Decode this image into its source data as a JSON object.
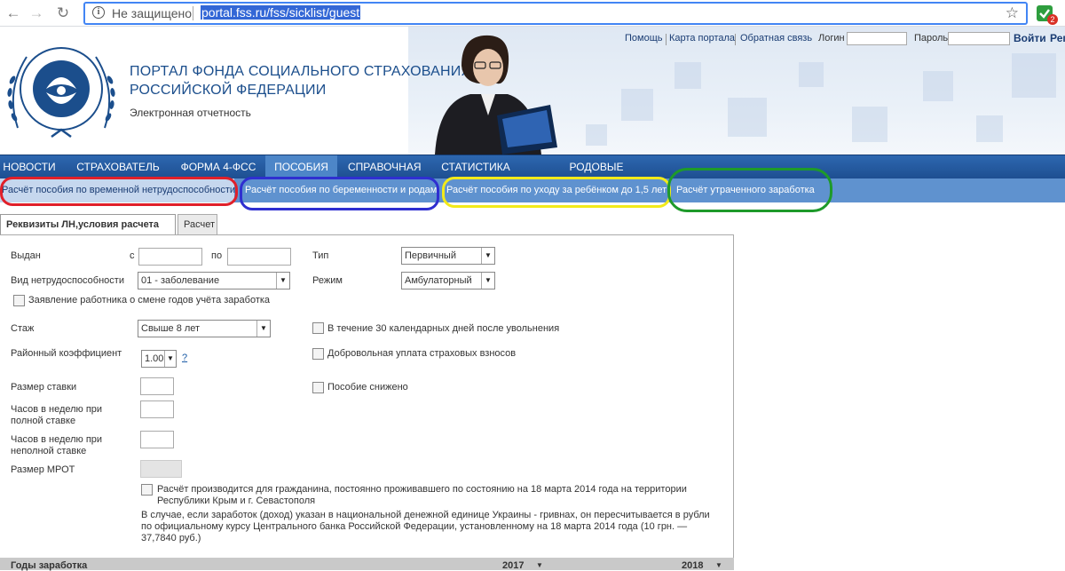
{
  "browser": {
    "back_icon": "arrow-left",
    "forward_icon": "arrow-right",
    "reload_icon": "reload",
    "security_label": "Не защищено",
    "url": "portal.fss.ru/fss/sicklist/guest",
    "extension_badge": "2"
  },
  "header": {
    "title_line1": "ПОРТАЛ ФОНДА СОЦИАЛЬНОГО СТРАХОВАНИЯ",
    "title_line2": "РОССИЙСКОЙ ФЕДЕРАЦИИ",
    "subtitle": "Электронная отчетность",
    "links": {
      "help": "Помощь",
      "sitemap": "Карта портала",
      "feedback": "Обратная связь",
      "login_label": "Логин",
      "password_label": "Пароль",
      "login_button": "Войти",
      "register": "Рег"
    }
  },
  "main_nav": [
    {
      "label": "НОВОСТИ"
    },
    {
      "label": "СТРАХОВАТЕЛЬ"
    },
    {
      "label": "ФОРМА 4-ФСС"
    },
    {
      "label": "ПОСОБИЯ"
    },
    {
      "label": "СПРАВОЧНАЯ"
    },
    {
      "label": "СТАТИСТИКА"
    },
    {
      "label": "РОДОВЫЕ СЕРТИФИКАТЫ"
    }
  ],
  "sub_nav": [
    {
      "label": "Расчёт пособия по временной нетрудоспособности"
    },
    {
      "label": "Расчёт пособия по беременности и родам"
    },
    {
      "label": "Расчёт пособия по уходу за ребёнком до 1,5 лет"
    },
    {
      "label": "Расчёт утраченного заработка"
    }
  ],
  "highlight_colors": [
    "#e0202a",
    "#2f2fd0",
    "#f2ea1a",
    "#1e9a2a"
  ],
  "tabs": [
    {
      "label": "Реквизиты ЛН,условия расчета"
    },
    {
      "label": "Расчет"
    }
  ],
  "form": {
    "issued_label": "Выдан",
    "from_label": "с",
    "to_label": "по",
    "type_label": "Тип",
    "type_value": "Первичный",
    "disability_label": "Вид нетрудоспособности",
    "disability_value": "01 - заболевание",
    "mode_label": "Режим",
    "mode_value": "Амбулаторный",
    "years_change_label": "Заявление работника о смене годов учёта заработка",
    "experience_label": "Стаж",
    "experience_value": "Свыше 8 лет",
    "within30_label": "В течение 30 календарных дней после увольнения",
    "regional_label": "Районный коэффициент",
    "regional_value": "1.00",
    "help_link": "?",
    "voluntary_label": "Добровольная уплата страховых взносов",
    "rate_label": "Размер ставки",
    "reduced_label": "Пособие снижено",
    "hours_full_label": "Часов в неделю при полной ставке",
    "hours_part_label": "Часов в неделю при неполной ставке",
    "mrot_label": "Размер МРОТ",
    "crimea_label": "Расчёт производится для гражданина, постоянно проживавшего по состоянию на 18 марта 2014 года на территории Республики Крым и г. Севастополя",
    "crimea_note": "В случае, если заработок (доход) указан в национальной денежной единице Украины - гривнах, он пересчитывается в рубли по официальному курсу Центрального банка Российской Федерации, установленному на 18 марта 2014 года (10 грн. — 37,7840 руб.)",
    "earnings_years_label": "Годы заработка",
    "year1": "2017",
    "year2": "2018"
  }
}
